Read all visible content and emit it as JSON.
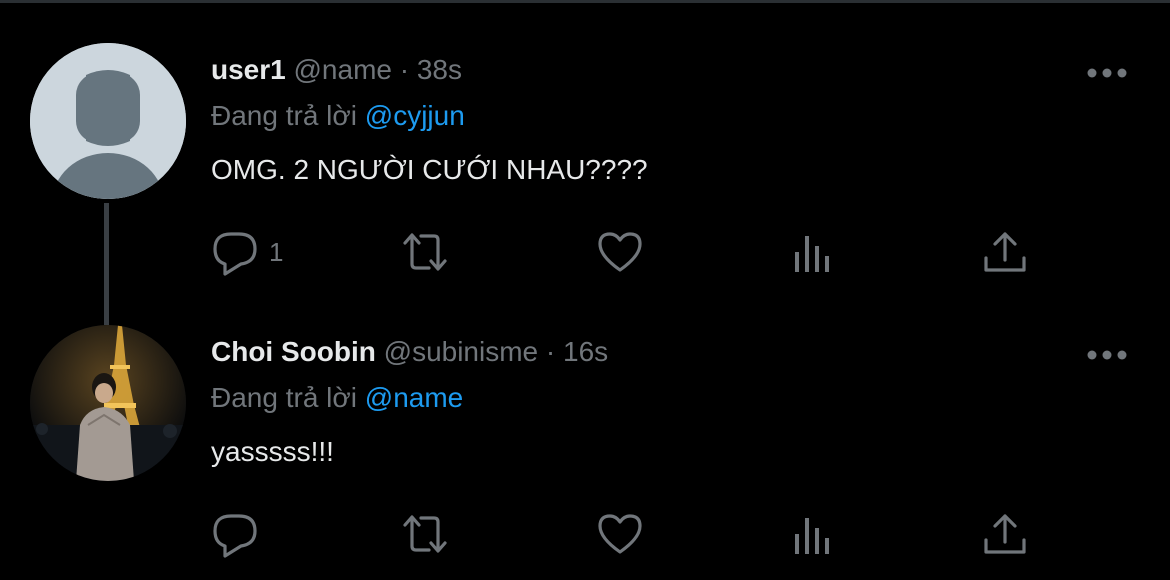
{
  "colors": {
    "background": "#000000",
    "primary_text": "#e7e9ea",
    "secondary_text": "#71767b",
    "accent_link": "#1d9bf0",
    "thread_line": "#3a3f44"
  },
  "tweets": [
    {
      "display_name": "user1",
      "handle": "@name",
      "separator": "·",
      "time": "38s",
      "reply_prefix": "Đang trả lời",
      "reply_to": "@cyjjun",
      "text": "OMG. 2 NGƯỜI CƯỚI NHAU????",
      "avatar": "default-avatar-silhouette",
      "actions": {
        "reply_count": "1",
        "icons": [
          "reply-icon",
          "retweet-icon",
          "like-icon",
          "analytics-icon",
          "share-icon"
        ]
      }
    },
    {
      "display_name": "Choi Soobin",
      "handle": "@subinisme",
      "separator": "·",
      "time": "16s",
      "reply_prefix": "Đang trả lời",
      "reply_to": "@name",
      "text": "yasssss!!!",
      "avatar": "profile-photo-eiffel-tower",
      "actions": {
        "reply_count": "",
        "icons": [
          "reply-icon",
          "retweet-icon",
          "like-icon",
          "analytics-icon",
          "share-icon"
        ]
      }
    }
  ]
}
